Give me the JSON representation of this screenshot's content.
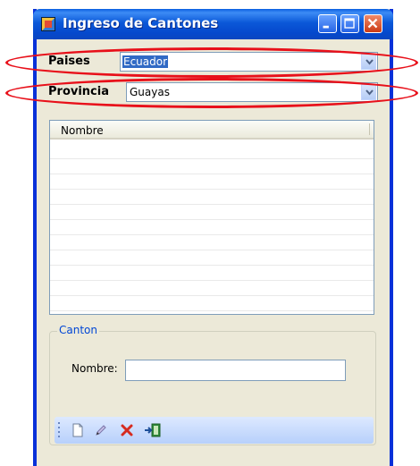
{
  "window": {
    "title": "Ingreso de Cantones"
  },
  "filters": {
    "paises_label": "Paises",
    "paises_value": "Ecuador",
    "provincia_label": "Provincia",
    "provincia_value": "Guayas"
  },
  "grid": {
    "columns": [
      "Nombre"
    ],
    "rows": []
  },
  "canton": {
    "legend": "Canton",
    "nombre_label": "Nombre:",
    "nombre_value": ""
  },
  "toolbar": {
    "items": [
      "new-document-icon",
      "edit-pencil-icon",
      "delete-x-icon",
      "exit-door-icon"
    ]
  },
  "colors": {
    "titlebar": "#0a58d8",
    "window_body": "#ece9d8",
    "annotation_ellipse": "#e8101a",
    "selection": "#316ac5",
    "toolbar": "#c8dbfb"
  }
}
